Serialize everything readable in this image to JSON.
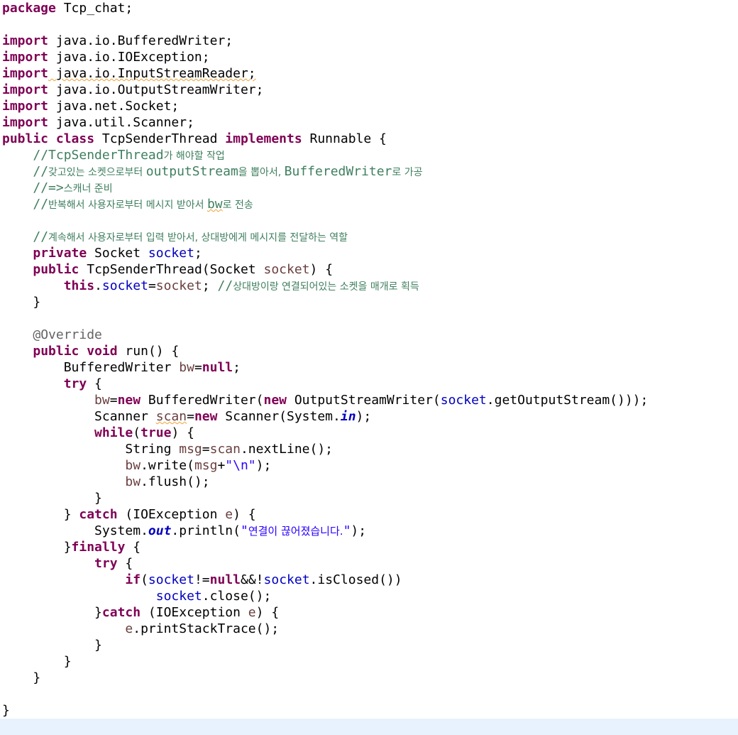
{
  "editor": {
    "current_line": "",
    "lines": {
      "l01": {
        "a": "package",
        "b": " Tcp_chat;"
      },
      "l03": {
        "a": "import",
        "b": " java.io.BufferedWriter;"
      },
      "l04": {
        "a": "import",
        "b": " java.io.IOException;"
      },
      "l05": {
        "a": "import",
        "b": " java.io.InputStreamReader;"
      },
      "l06": {
        "a": "import",
        "b": " java.io.OutputStreamWriter;"
      },
      "l07": {
        "a": "import",
        "b": " java.net.Socket;"
      },
      "l08": {
        "a": "import",
        "b": " java.util.Scanner;"
      },
      "l09": {
        "a": "public",
        "b": " ",
        "c": "class",
        "d": " TcpSenderThread ",
        "e": "implements",
        "f": " Runnable {"
      },
      "l10": {
        "a": "    ",
        "b": "//TcpSenderThread",
        "c": "가 해야할 작업"
      },
      "l11": {
        "a": "    ",
        "b": "//",
        "c": "갖고있는 소켓으로부터 ",
        "d": "outputStream",
        "e": "을 뽑아서, ",
        "f": "BufferedWriter",
        "g": "로 가공"
      },
      "l12": {
        "a": "    ",
        "b": "//=>",
        "c": "스캐너 준비"
      },
      "l13": {
        "a": "    ",
        "b": "//",
        "c": "반복해서 사용자로부터 메시지 받아서 ",
        "d": "bw",
        "e": "로 전송"
      },
      "l15": {
        "a": "    ",
        "b": "//",
        "c": "계속해서 사용자로부터 입력 받아서, 상대방에게 메시지를 전달하는 역할"
      },
      "l16": {
        "a": "    ",
        "b": "private",
        "c": " Socket ",
        "d": "socket",
        "e": ";"
      },
      "l17": {
        "a": "    ",
        "b": "public",
        "c": " TcpSenderThread(Socket ",
        "d": "socket",
        "e": ") {"
      },
      "l18": {
        "a": "        ",
        "b": "this",
        "c": ".",
        "d": "socket",
        "e": "=",
        "f": "socket",
        "g": "; ",
        "h": "//",
        "i": "상대방이랑 연결되어있는 소켓을 매개로 획득"
      },
      "l19": {
        "a": "    }"
      },
      "l21": {
        "a": "    ",
        "b": "@Override"
      },
      "l22": {
        "a": "    ",
        "b": "public",
        "c": " ",
        "d": "void",
        "e": " run() {"
      },
      "l23": {
        "a": "        BufferedWriter ",
        "b": "bw",
        "c": "=",
        "d": "null",
        "e": ";"
      },
      "l24": {
        "a": "        ",
        "b": "try",
        "c": " {"
      },
      "l25": {
        "a": "            ",
        "b": "bw",
        "c": "=",
        "d": "new",
        "e": " BufferedWriter(",
        "f": "new",
        "g": " OutputStreamWriter(",
        "h": "socket",
        "i": ".getOutputStream()));"
      },
      "l26": {
        "a": "            Scanner ",
        "b": "scan",
        "c": "=",
        "d": "new",
        "e": " Scanner(System.",
        "f": "in",
        "g": ");"
      },
      "l27": {
        "a": "            ",
        "b": "while",
        "c": "(",
        "d": "true",
        "e": ") {"
      },
      "l28": {
        "a": "                String ",
        "b": "msg",
        "c": "=",
        "d": "scan",
        "e": ".nextLine();"
      },
      "l29": {
        "a": "                ",
        "b": "bw",
        "c": ".write(",
        "d": "msg",
        "e": "+",
        "f": "\"\\n\"",
        "g": ");"
      },
      "l30": {
        "a": "                ",
        "b": "bw",
        "c": ".flush();"
      },
      "l31": {
        "a": "            }"
      },
      "l32": {
        "a": "        } ",
        "b": "catch",
        "c": " (IOException ",
        "d": "e",
        "e": ") {"
      },
      "l33": {
        "a": "            System.",
        "b": "out",
        "c": ".println(",
        "d": "\"",
        "e": "연결이 끊어졌습니다.",
        "f": "\"",
        "g": ");"
      },
      "l34": {
        "a": "        }",
        "b": "finally",
        "c": " {"
      },
      "l35": {
        "a": "            ",
        "b": "try",
        "c": " {"
      },
      "l36": {
        "a": "                ",
        "b": "if",
        "c": "(",
        "d": "socket",
        "e": "!=",
        "f": "null",
        "g": "&&!",
        "h": "socket",
        "i": ".isClosed())"
      },
      "l37": {
        "a": "                    ",
        "b": "socket",
        "c": ".close();"
      },
      "l38": {
        "a": "            }",
        "b": "catch",
        "c": " (IOException ",
        "d": "e",
        "e": ") {"
      },
      "l39": {
        "a": "                ",
        "b": "e",
        "c": ".printStackTrace();"
      },
      "l40": {
        "a": "            }"
      },
      "l41": {
        "a": "        }"
      },
      "l42": {
        "a": "    }"
      },
      "l44": {
        "a": "}"
      }
    }
  }
}
